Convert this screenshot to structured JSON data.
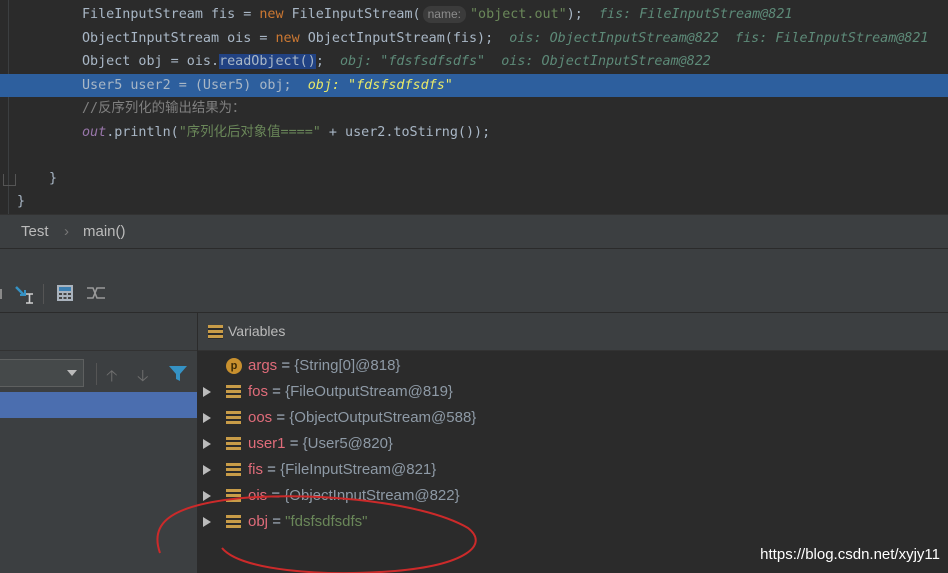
{
  "editor": {
    "lines": [
      {
        "segments": [
          {
            "t": "FileInputStream fis = "
          },
          {
            "t": "new ",
            "c": "kw"
          },
          {
            "t": "FileInputStream("
          },
          {
            "t": "name:",
            "c": "hint"
          },
          {
            "t": "\"object.out\"",
            "c": "str"
          },
          {
            "t": ");  "
          },
          {
            "t": "fis: FileInputStream@821",
            "c": "inline-val"
          }
        ]
      },
      {
        "segments": [
          {
            "t": "ObjectInputStream ois = "
          },
          {
            "t": "new ",
            "c": "kw"
          },
          {
            "t": "ObjectInputStream(fis);  "
          },
          {
            "t": "ois: ObjectInputStream@822  fis: FileInputStream@821",
            "c": "inline-val"
          }
        ]
      },
      {
        "segments": [
          {
            "t": "Object obj = ois."
          },
          {
            "t": "readObject()",
            "c": "selword"
          },
          {
            "t": ";  "
          },
          {
            "t": "obj: \"fdsfsdfsdfs\"  ois: ObjectInputStream@822",
            "c": "inline-val"
          }
        ]
      },
      {
        "highlight": true,
        "segments": [
          {
            "t": "User5 user2 = (User5) obj;  "
          },
          {
            "t": "obj: \"fdsfsdfsdfs\"",
            "c": "inline-val-hl"
          }
        ]
      },
      {
        "segments": [
          {
            "t": "//反序列化的输出结果为：",
            "c": "comment"
          }
        ]
      },
      {
        "segments": [
          {
            "t": "out",
            "c": "field"
          },
          {
            "t": ".println("
          },
          {
            "t": "\"序列化后对象值====\"",
            "c": "str"
          },
          {
            "t": " + user2.toStirng());"
          }
        ]
      }
    ],
    "closing_brace_inner": "}",
    "closing_brace_outer": "}"
  },
  "breadcrumb": {
    "class_name": "Test",
    "separator": "›",
    "method": "main()"
  },
  "variables": {
    "title": "Variables",
    "items": [
      {
        "icon": "p",
        "name": "args",
        "eq": " = ",
        "value": "{String[0]@818}",
        "expandable": false
      },
      {
        "icon": "stack",
        "name": "fos",
        "eq": " = ",
        "value": "{FileOutputStream@819}",
        "expandable": true
      },
      {
        "icon": "stack",
        "name": "oos",
        "eq": " = ",
        "value": "{ObjectOutputStream@588}",
        "expandable": true
      },
      {
        "icon": "stack",
        "name": "user1",
        "eq": " = ",
        "value": "{User5@820}",
        "expandable": true
      },
      {
        "icon": "stack",
        "name": "fis",
        "eq": " = ",
        "value": "{FileInputStream@821}",
        "expandable": true
      },
      {
        "icon": "stack",
        "name": "ois",
        "eq": " = ",
        "value": "{ObjectInputStream@822}",
        "expandable": true
      },
      {
        "icon": "stack",
        "name": "obj",
        "eq": " = ",
        "value": "\"fdsfsdfsdfs\"",
        "expandable": true,
        "string": true
      }
    ]
  },
  "watermark": "https://blog.csdn.net/xyjy11",
  "colors": {
    "highlight": "#2d5f9e",
    "selected_frame": "#4b6eaf",
    "annotation": "#cc2a2a"
  }
}
